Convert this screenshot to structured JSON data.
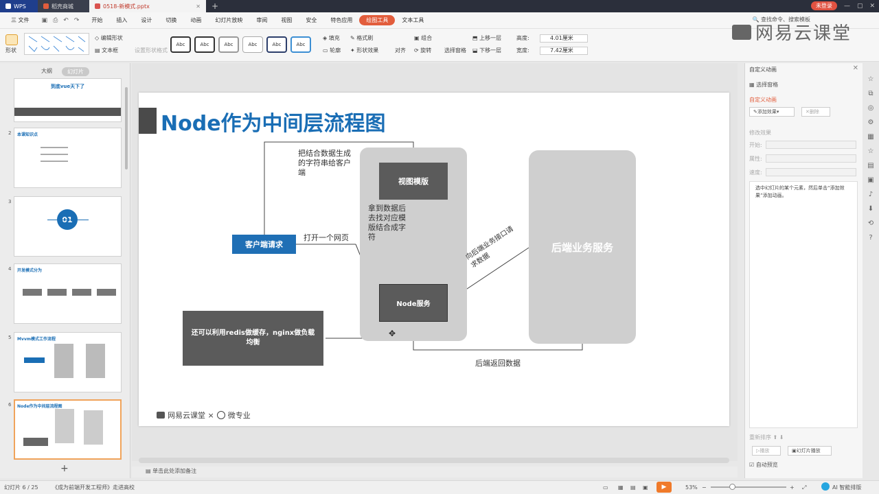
{
  "titlebar": {
    "wps_label": "WPS",
    "home_tab": "稻壳商城",
    "doc_tab": "0518-新模式.pptx",
    "login_button": "未登录"
  },
  "menu": {
    "file": "三 文件",
    "items": [
      "开始",
      "插入",
      "设计",
      "切换",
      "动画",
      "幻灯片放映",
      "审阅",
      "视图",
      "安全",
      "特色应用",
      "绘图工具",
      "文本工具"
    ],
    "active_index": 10,
    "search_hint": "查找命令、搜索模板"
  },
  "ribbon": {
    "shape_label": "形状",
    "edit_shape": "编辑形状",
    "text_box": "文本框",
    "set_shape_format": "设置形状格式",
    "style_labels": [
      "Abc",
      "Abc",
      "Abc",
      "Abc",
      "Abc",
      "Abc"
    ],
    "fill": "填充",
    "outline": "轮廓",
    "format_painter": "格式刷",
    "shape_effect": "形状效果",
    "align": "对齐",
    "group": "组合",
    "rotate": "旋转",
    "select_pane": "选择窗格",
    "bring_forward": "上移一层",
    "send_backward": "下移一层",
    "height_label": "高度:",
    "height_value": "4.01厘米",
    "width_label": "宽度:",
    "width_value": "7.42厘米"
  },
  "watermark": "网易云课堂",
  "left_panel": {
    "tab_outline": "大纲",
    "tab_slides": "幻灯片",
    "thumbnails": [
      {
        "num": "",
        "title": "到底vue天下了"
      },
      {
        "num": "2",
        "title": "本课知识点"
      },
      {
        "num": "3",
        "title": "01"
      },
      {
        "num": "4",
        "title": "开发模式分为"
      },
      {
        "num": "5",
        "title": "Mvvm模式工作流程"
      },
      {
        "num": "6",
        "title": "Node作为中间层流程图"
      }
    ],
    "add_button": "+"
  },
  "slide": {
    "title": "Node作为中间层流程图",
    "client_request": "客户端请求",
    "view_template": "视图模版",
    "node_service": "Node服务",
    "backend_service": "后端业务服务",
    "redis_note": "还可以利用redis做缓存，nginx做负载均衡",
    "label_string_to_client": "把结合数据生成的字符串给客户端",
    "label_open_page": "打开一个网页",
    "label_find_template": "拿到数据后去找对应模版结合成字符",
    "label_request_backend": "向后端业务接口请求数据",
    "label_backend_return": "后端返回数据",
    "footer_brand": "网易云课堂 ×",
    "footer_partner": "微专业"
  },
  "notes": "单击此处添加备注",
  "right_panel": {
    "title": "自定义动画",
    "select_pane": "选择窗格",
    "custom_anim": "自定义动画",
    "add_effect": "添加效果",
    "delete": "删除",
    "modify_effect": "修改效果",
    "start": "开始:",
    "property": "属性:",
    "speed": "速度:",
    "hint": "选中幻灯片的某个元素，然后单击“添加效果”添加动画。",
    "reorder": "重新排序",
    "play": "播放",
    "slide_show": "幻灯片播放",
    "auto_preview": "自动预览"
  },
  "status": {
    "slide_info": "幻灯片 6 / 25",
    "theme": "《成为前端开发工程师》走进高校",
    "zoom": "53%",
    "ai": "AI 智能排版"
  },
  "colors": {
    "title_blue": "#1a6eb5",
    "client_box": "#1f6fb5",
    "dark_box": "#5b5b5b",
    "light_panel": "#cfcfcf",
    "accent_orange": "#e25d3c"
  }
}
